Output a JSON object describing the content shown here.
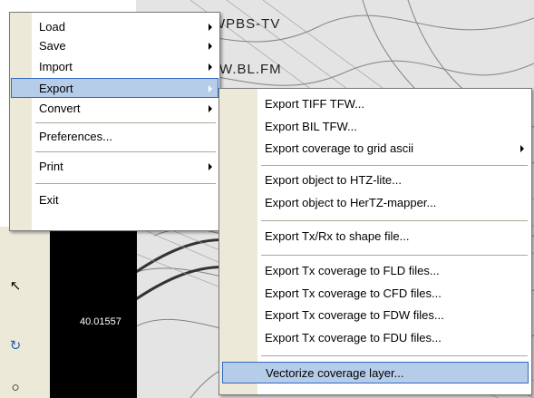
{
  "coordinate_readout": "40.01557",
  "map_labels": [
    "WPBS-TV",
    "W.BL.FM"
  ],
  "main_menu": {
    "items": [
      {
        "label": "Load",
        "submenu": true
      },
      {
        "label": "Save",
        "submenu": true
      },
      {
        "label": "Import",
        "submenu": true
      },
      {
        "label": "Export",
        "submenu": true,
        "highlighted": true
      },
      {
        "label": "Convert",
        "submenu": true
      },
      {
        "label": "Preferences...",
        "submenu": false
      },
      {
        "label": "Print",
        "submenu": true
      },
      {
        "label": "Exit",
        "submenu": false
      }
    ]
  },
  "export_submenu": {
    "items": [
      {
        "label": "Export TIFF TFW...",
        "submenu": false
      },
      {
        "label": "Export BIL TFW...",
        "submenu": false
      },
      {
        "label": "Export coverage to grid ascii",
        "submenu": true
      },
      {
        "label": "Export object to HTZ-lite...",
        "submenu": false
      },
      {
        "label": "Export object to HerTZ-mapper...",
        "submenu": false
      },
      {
        "label": "Export Tx/Rx to shape file...",
        "submenu": false
      },
      {
        "label": "Export Tx coverage to FLD files...",
        "submenu": false
      },
      {
        "label": "Export Tx coverage to CFD files...",
        "submenu": false
      },
      {
        "label": "Export Tx coverage to FDW files...",
        "submenu": false
      },
      {
        "label": "Export Tx coverage to FDU files...",
        "submenu": false
      },
      {
        "label": "Vectorize coverage layer...",
        "submenu": false,
        "highlighted": true
      }
    ]
  },
  "colors": {
    "highlight_fill": "#b6cdea",
    "highlight_border": "#3169c6",
    "gutter": "#ece9d8"
  }
}
